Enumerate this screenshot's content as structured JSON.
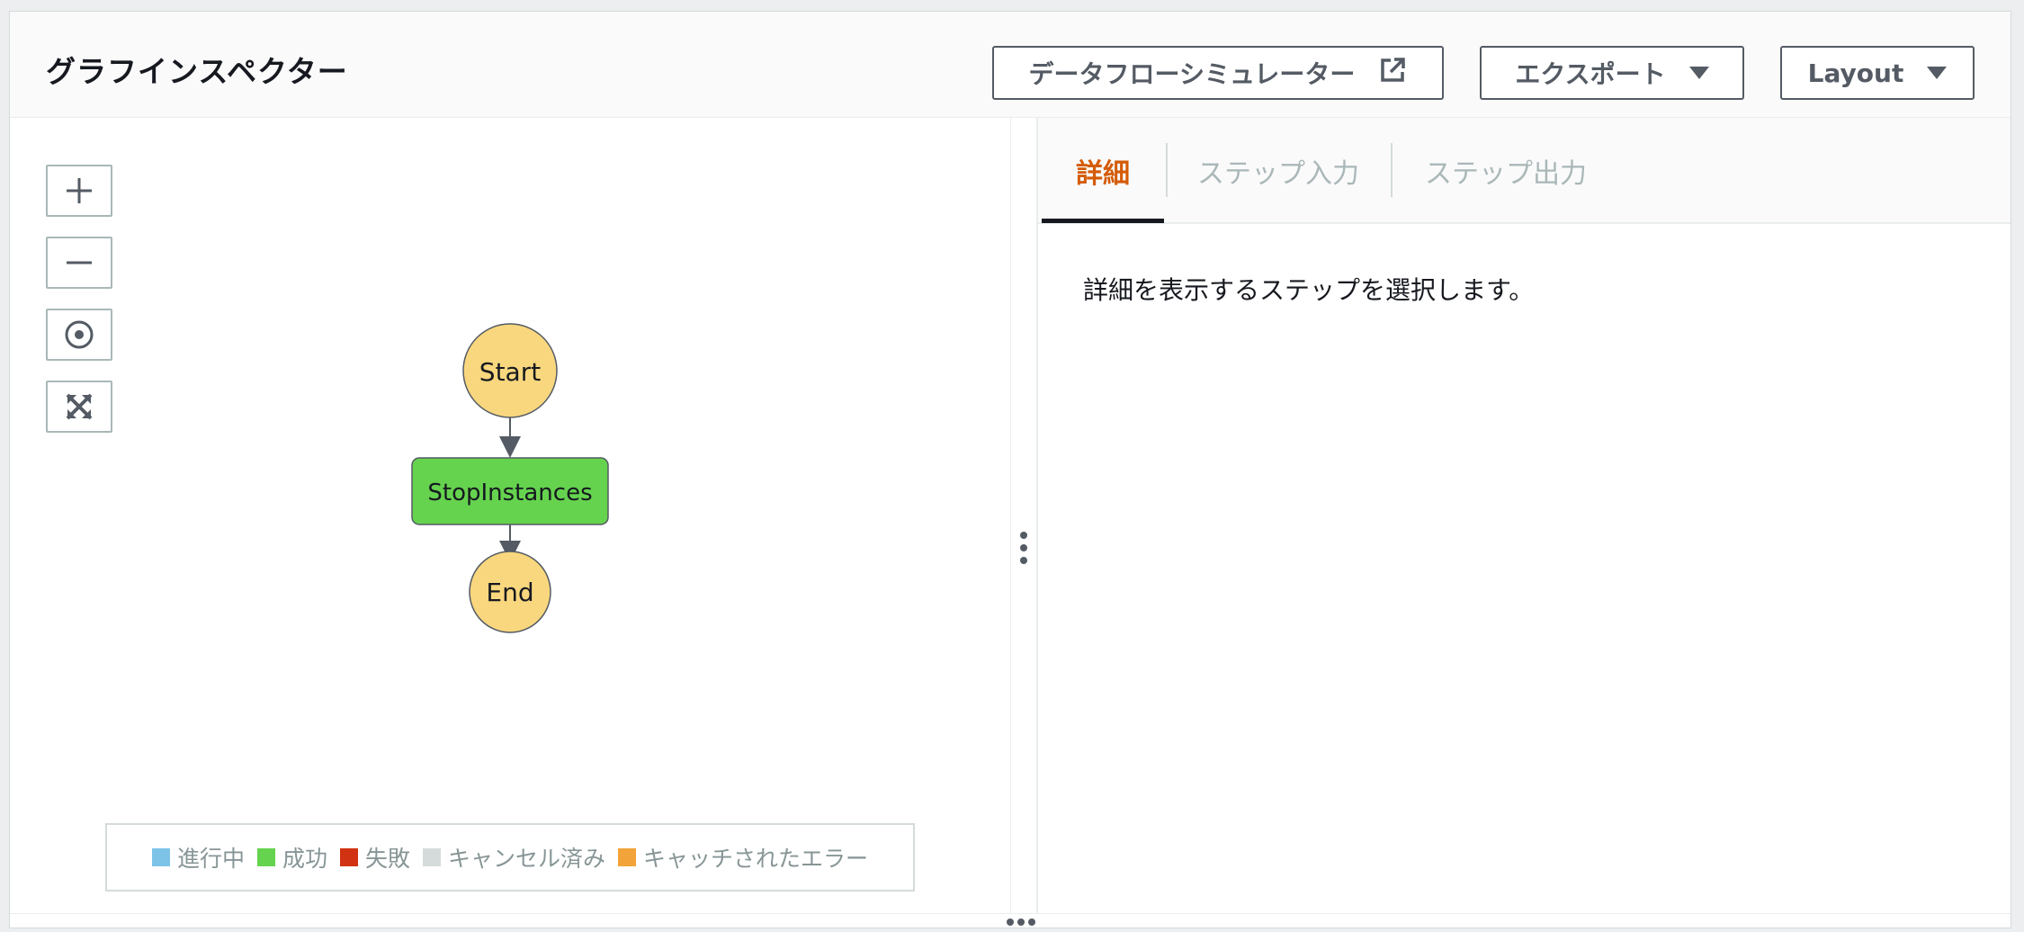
{
  "header": {
    "title": "グラフインスペクター",
    "simulator_button": "データフローシミュレーター",
    "export_button": "エクスポート",
    "layout_button": "Layout"
  },
  "graph": {
    "nodes": {
      "start": "Start",
      "task": "StopInstances",
      "end": "End"
    },
    "colors": {
      "terminal_fill": "#f9d77e",
      "task_fill": "#65d34e",
      "stroke": "#545b64"
    }
  },
  "zoom_controls": {
    "zoom_in_icon": "plus-icon",
    "zoom_out_icon": "minus-icon",
    "center_icon": "target-icon",
    "fit_icon": "expand-icon"
  },
  "legend": {
    "items": [
      {
        "label": "進行中",
        "color": "#7dc3e8"
      },
      {
        "label": "成功",
        "color": "#65d34e"
      },
      {
        "label": "失敗",
        "color": "#d13212"
      },
      {
        "label": "キャンセル済み",
        "color": "#d5dbdb"
      },
      {
        "label": "キャッチされたエラー",
        "color": "#f2a33a"
      }
    ]
  },
  "tabs": {
    "details": "詳細",
    "step_input": "ステップ入力",
    "step_output": "ステップ出力"
  },
  "details_panel": {
    "message": "詳細を表示するステップを選択します。"
  },
  "colors": {
    "accent": "#d45b07",
    "border": "#545b64"
  }
}
